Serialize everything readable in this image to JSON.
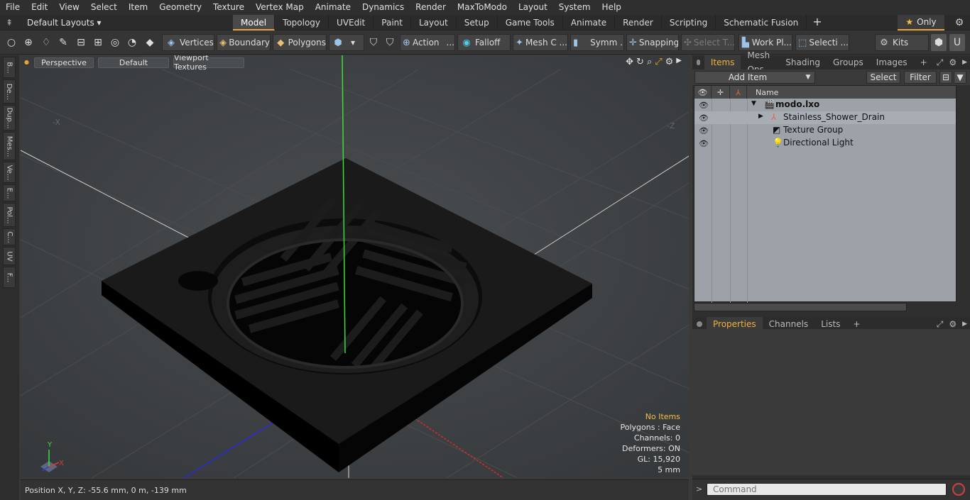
{
  "menu": [
    "File",
    "Edit",
    "View",
    "Select",
    "Item",
    "Geometry",
    "Texture",
    "Vertex Map",
    "Animate",
    "Dynamics",
    "Render",
    "MaxToModo",
    "Layout",
    "System",
    "Help"
  ],
  "layout_selector": "Default Layouts ▾",
  "mode_tabs": [
    "Model",
    "Topology",
    "UVEdit",
    "Paint",
    "Layout",
    "Setup",
    "Game Tools",
    "Animate",
    "Render",
    "Scripting",
    "Schematic Fusion"
  ],
  "active_mode_tab": "Model",
  "only_label": "Only",
  "toolbar": {
    "vertices": "Vertices",
    "boundary": "Boundary",
    "polygons": "Polygons",
    "action": "Action",
    "action_more": "...",
    "falloff": "Falloff",
    "mesh": "Mesh C ...",
    "symm": "Symm ...",
    "snapping": "Snapping",
    "select_t": "Select T...",
    "workplane": "Work Pl...",
    "selecti": "Selecti ...",
    "kits": "Kits"
  },
  "left_tabs": [
    "B...",
    "De...",
    "Dup...",
    "Mes...",
    "Ve...",
    "E...",
    "Pol...",
    "C...",
    "UV",
    "F..."
  ],
  "viewport": {
    "view": "Perspective",
    "shading": "Default",
    "textures": "Viewport Textures",
    "neg_x_label": "-X",
    "neg_z_label": "-Z",
    "info": {
      "selection": "No Items",
      "polygons": "Polygons : Face",
      "channels": "Channels: 0",
      "deformers": "Deformers: ON",
      "gl": "GL: 15,920",
      "scale": "5 mm"
    },
    "axis_y": "Y",
    "axis_x": "X"
  },
  "status": {
    "position": "Position X, Y, Z:   -55.6 mm, 0 m, -139 mm"
  },
  "items_panel": {
    "tabs": [
      "Items",
      "Mesh Ops",
      "Shading",
      "Groups",
      "Images"
    ],
    "active_tab": "Items",
    "add_item": "Add Item",
    "select": "Select",
    "filter": "Filter",
    "name_header": "Name",
    "rows": [
      {
        "label": "modo.lxo",
        "bold": true
      },
      {
        "label": "Stainless_Shower_Drain"
      },
      {
        "label": "Texture Group"
      },
      {
        "label": "Directional Light"
      }
    ]
  },
  "properties_panel": {
    "tabs": [
      "Properties",
      "Channels",
      "Lists"
    ],
    "active_tab": "Properties"
  },
  "command": {
    "placeholder": "Command"
  },
  "colors": {
    "accent": "#e8a23a",
    "drain": "#111111",
    "y_axis": "#3ddc3d"
  }
}
